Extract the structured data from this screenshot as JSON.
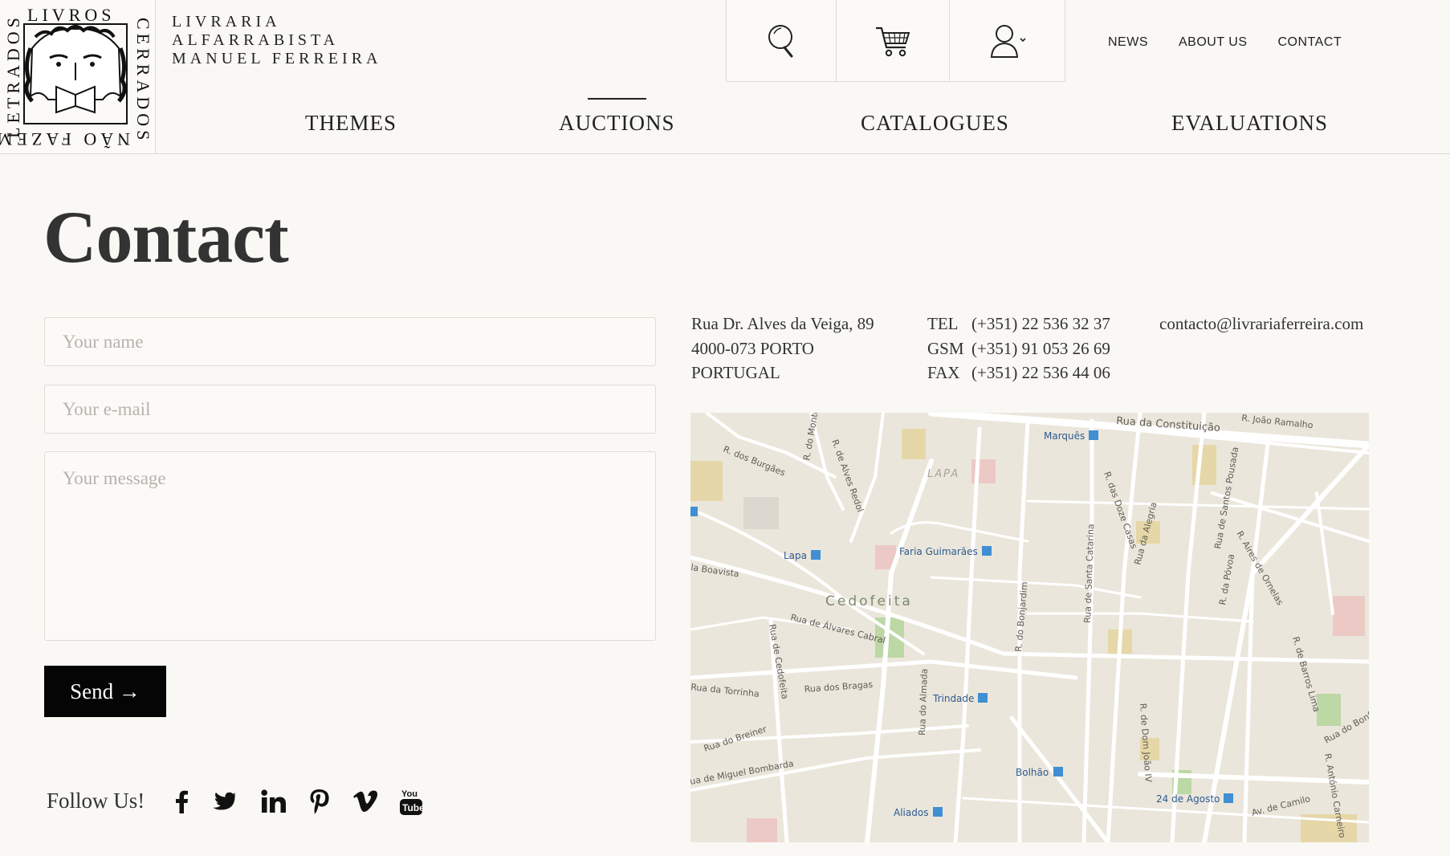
{
  "logo": {
    "top": "LIVROS",
    "left": "LETRADOS",
    "right": "CERRADOS",
    "bottom": "NÃO FAZEM"
  },
  "brand": {
    "line1": "LIVRARIA",
    "line2": "ALFARRABISTA",
    "line3": "MANUEL FERREIRA"
  },
  "header_icons": [
    "search-icon",
    "cart-icon",
    "user-icon"
  ],
  "top_links": [
    "NEWS",
    "ABOUT US",
    "CONTACT"
  ],
  "nav": {
    "items": [
      "THEMES",
      "AUCTIONS",
      "CATALOGUES",
      "EVALUATIONS"
    ],
    "active": "AUCTIONS"
  },
  "page_title": "Contact",
  "form": {
    "name_placeholder": "Your name",
    "email_placeholder": "Your e-mail",
    "message_placeholder": "Your message",
    "send_label": "Send →"
  },
  "follow_label": "Follow Us!",
  "social": [
    "facebook-icon",
    "twitter-icon",
    "linkedin-icon",
    "pinterest-icon",
    "vimeo-icon",
    "youtube-icon"
  ],
  "address": {
    "line1": "Rua Dr. Alves da Veiga, 89",
    "line2": "4000-073 PORTO",
    "line3": "PORTUGAL"
  },
  "phones": {
    "tel_label": "TEL",
    "tel": "(+351) 22 536 32 37",
    "gsm_label": "GSM",
    "gsm": "(+351) 91 053 26  69",
    "fax_label": "FAX",
    "fax": "(+351) 22 536 44 06"
  },
  "email": "contacto@livrariaferreira.com",
  "map": {
    "district_lapa": "LAPA",
    "district_cedofeita": "Cedofeita",
    "stations": [
      "Marquês",
      "Faria Guimarães",
      "Lapa",
      "Trindade",
      "Bolhão",
      "Aliados",
      "24 de Agosto"
    ],
    "streets": [
      "Rua da Constituição",
      "R. João Ramalho",
      "R. dos Burgães",
      "R. do Monte",
      "R. de Alves Redol",
      "R. das Doze Casas",
      "Rua da Alegria",
      "Rua de Santos Pousada",
      "R. Aires de Ornelas",
      "la Boavista",
      "R. da Póvoa",
      "Rua de Santa Catarina",
      "R. do Bonjardim",
      "Rua de Álvares Cabral",
      "Rua de Cedofeita",
      "R. de Barros Lima",
      "Rua da Torrinha",
      "Rua dos Bragas",
      "Rua do Almada",
      "R. de Dom João IV",
      "Rua do Breiner",
      "ua de Miguel Bombarda",
      "Av. de Camilo",
      "R. António Carneiro",
      "Rua do Bonf"
    ]
  },
  "colors": {
    "background": "#f9f8f4",
    "button": "#050505",
    "text": "#333333",
    "metro": "#3f8fd2"
  }
}
